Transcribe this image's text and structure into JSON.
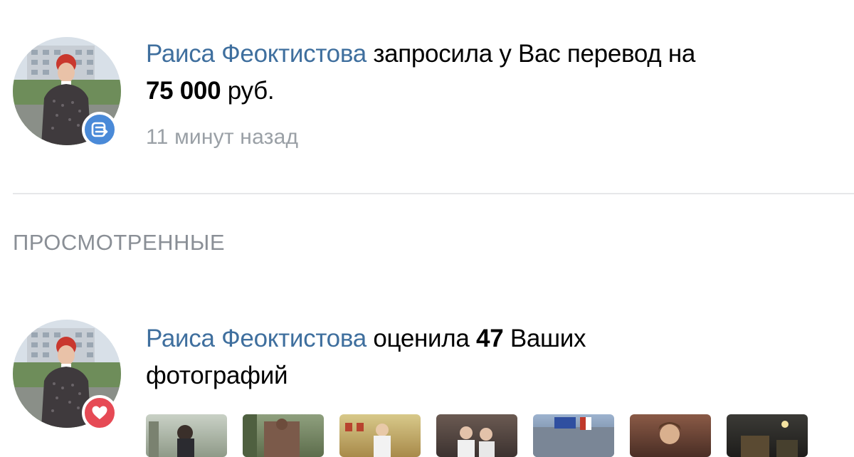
{
  "notifications": [
    {
      "name": "Раиса Феоктистова",
      "action": "запросила у Вас перевод на",
      "amount": "75 000",
      "currency": "руб.",
      "time": "11 минут назад",
      "badge_icon": "money-transfer-icon",
      "badge_color": "#4a8ad8"
    },
    {
      "name": "Раиса Феоктистова",
      "action": "оценила",
      "count": "47",
      "tail": "Ваших",
      "line2": "фотографий",
      "badge_icon": "heart-icon",
      "badge_color": "#e64a55"
    }
  ],
  "section": {
    "header": "ПРОСМОТРЕННЫЕ"
  },
  "colors": {
    "link": "#3f6f9e",
    "muted": "#9aa0a6",
    "divider": "#e6e7e9"
  }
}
